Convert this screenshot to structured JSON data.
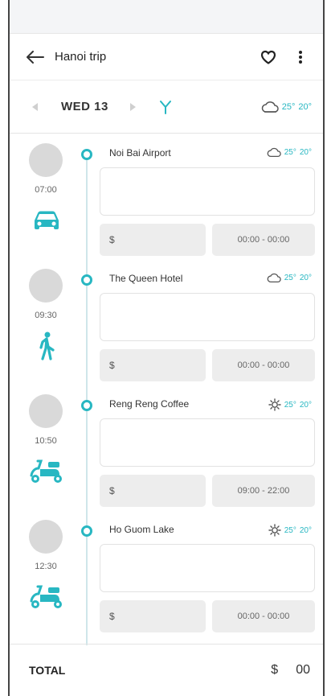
{
  "header": {
    "title": "Hanoi trip",
    "icons": {
      "back": "arrow-left-icon",
      "favorite": "heart-icon",
      "menu": "more-vertical-icon"
    }
  },
  "day": {
    "label": "WED 13",
    "weather": {
      "icon": "cloud-icon",
      "high": "25°",
      "low": "20°"
    },
    "icons": {
      "prev": "chevron-left-icon",
      "next": "chevron-right-icon",
      "filter": "fork-icon"
    }
  },
  "stops": [
    {
      "place": "Noi Bai Airport",
      "time": "07:00",
      "mode": "car",
      "weather_icon": "cloud-icon",
      "high": "25°",
      "low": "20°",
      "price": "$",
      "hours": "00:00 - 00:00"
    },
    {
      "place": "The Queen Hotel",
      "time": "09:30",
      "mode": "walk",
      "weather_icon": "cloud-icon",
      "high": "25°",
      "low": "20°",
      "price": "$",
      "hours": "00:00 - 00:00"
    },
    {
      "place": "Reng Reng Coffee",
      "time": "10:50",
      "mode": "scooter",
      "weather_icon": "sun-icon",
      "high": "25°",
      "low": "20°",
      "price": "$",
      "hours": "09:00 - 22:00"
    },
    {
      "place": "Ho Guom Lake",
      "time": "12:30",
      "mode": "scooter",
      "weather_icon": "sun-icon",
      "high": "25°",
      "low": "20°",
      "price": "$",
      "hours": "00:00 - 00:00"
    }
  ],
  "footer": {
    "label": "TOTAL",
    "currency": "$",
    "amount": "00"
  },
  "colors": {
    "accent": "#28b7c2",
    "field": "#ededed",
    "avatar": "#d9d9d9"
  }
}
